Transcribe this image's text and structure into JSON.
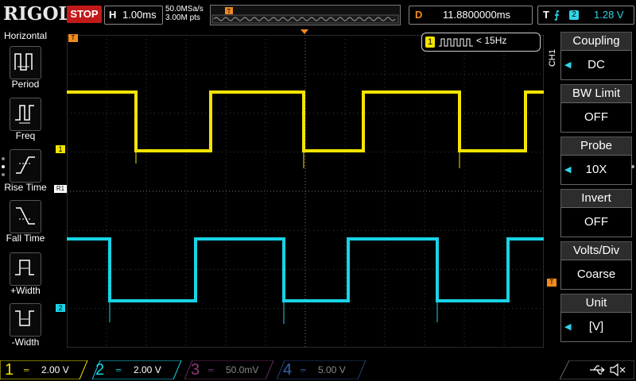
{
  "app": {
    "brand": "RIGOL",
    "run_state": "STOP"
  },
  "timebase": {
    "prefix": "H",
    "scale": "1.00ms",
    "sample_rate": "50.0MSa/s",
    "memory_depth": "3.00M pts"
  },
  "delay": {
    "prefix": "D",
    "value": "11.8800000ms"
  },
  "trigger": {
    "prefix": "T",
    "source": "2",
    "level": "1.28 V",
    "edge_icon": "rising-edge-icon"
  },
  "left_menu": {
    "title": "Horizontal",
    "items": [
      {
        "label": "Period",
        "icon": "period-icon"
      },
      {
        "label": "Freq",
        "icon": "freq-icon"
      },
      {
        "label": "Rise Time",
        "icon": "rise-time-icon"
      },
      {
        "label": "Fall Time",
        "icon": "fall-time-icon"
      },
      {
        "label": "+Width",
        "icon": "pos-width-icon"
      },
      {
        "label": "-Width",
        "icon": "neg-width-icon"
      }
    ]
  },
  "measurement": {
    "channel": "1",
    "readout": "< 15Hz"
  },
  "markers": {
    "ch1": "1",
    "ch2": "2",
    "ref": "R1",
    "trig_level": "T",
    "trig_pos": "T"
  },
  "right_menu": {
    "channel_tag": "CH1",
    "items": [
      {
        "title": "Coupling",
        "value": "DC",
        "has_arrow": true
      },
      {
        "title": "BW Limit",
        "value": "OFF",
        "has_arrow": false
      },
      {
        "title": "Probe",
        "value": "10X",
        "has_arrow": true
      },
      {
        "title": "Invert",
        "value": "OFF",
        "has_arrow": false
      },
      {
        "title": "Volts/Div",
        "value": "Coarse",
        "has_arrow": false
      },
      {
        "title": "Unit",
        "value": "[V]",
        "has_arrow": true
      }
    ]
  },
  "channels": [
    {
      "num": "1",
      "scale": "2.00 V",
      "color": "#f5e400"
    },
    {
      "num": "2",
      "scale": "2.00 V",
      "color": "#19d3e6"
    },
    {
      "num": "3",
      "scale": "50.0mV",
      "color": "#c23aa8"
    },
    {
      "num": "4",
      "scale": "5.00 V",
      "color": "#2e6fd8"
    }
  ],
  "colors": {
    "ch1": "#f5e400",
    "ch2": "#19d3e6",
    "trigger": "#f28a1e",
    "accent": "#2fd6e8"
  }
}
